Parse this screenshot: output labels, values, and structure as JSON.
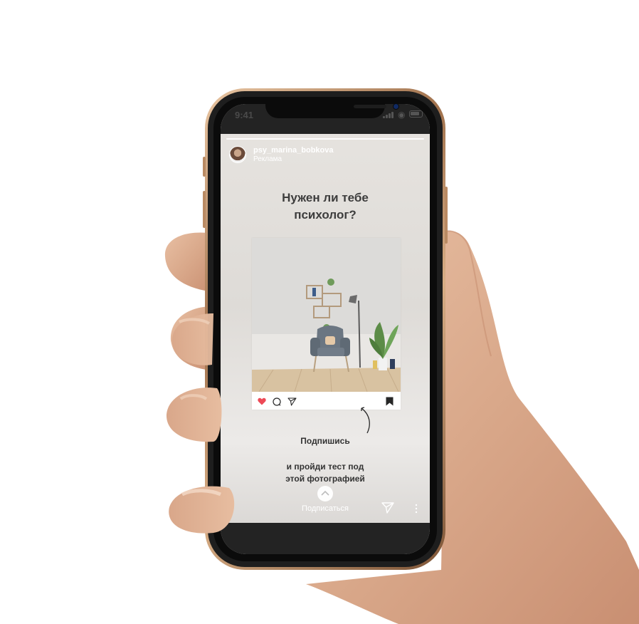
{
  "status_bar": {
    "time": "9:41",
    "signal_icon": "signal-bars-icon",
    "wifi_icon": "wifi-icon",
    "battery_icon": "battery-icon"
  },
  "story": {
    "progress": 1.0,
    "author": {
      "username": "psy_marina_bobkova",
      "label": "Реклама"
    },
    "headline_line1": "Нужен ли тебе",
    "headline_line2": "психолог?",
    "post_preview": {
      "image": "living-room-armchair-photo",
      "actions": [
        "heart-icon",
        "comment-icon",
        "share-icon",
        "bookmark-icon"
      ],
      "liked": true
    },
    "cta_title": "Подпишись",
    "cta_line1": "и пройди тест под",
    "cta_line2": "этой фотографией",
    "swipe_up_label": "Подписаться",
    "footer_icons": [
      "send-icon",
      "more-icon"
    ]
  },
  "colors": {
    "heart": "#ed4956",
    "text_dark": "#333333",
    "frame_gold": "#c49a72",
    "screen_bg": "#e5e2de"
  }
}
